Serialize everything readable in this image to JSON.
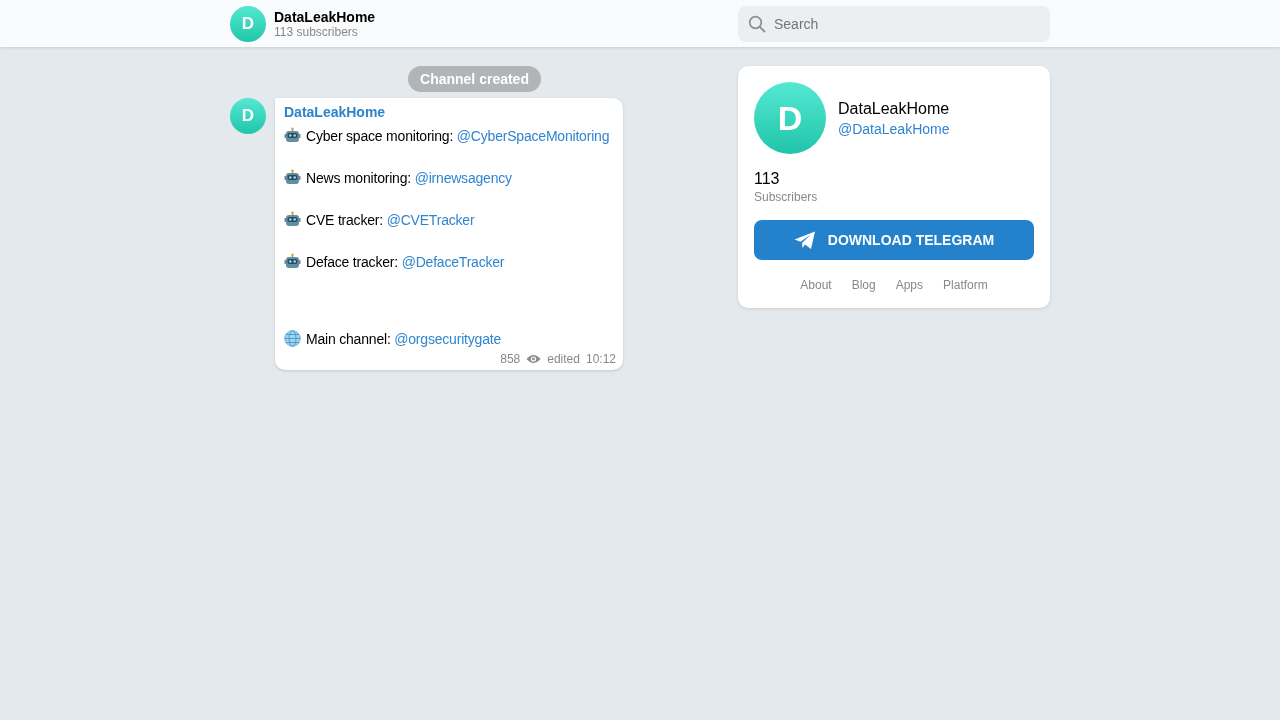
{
  "header": {
    "avatar_letter": "D",
    "title": "DataLeakHome",
    "subtitle": "113 subscribers",
    "search": {
      "placeholder": "Search"
    }
  },
  "service_message": "Channel created",
  "post": {
    "avatar_letter": "D",
    "author": "DataLeakHome",
    "lines": [
      {
        "kind": "bot",
        "text": "Cyber space monitoring: ",
        "link": "@CyberSpaceMonitoring"
      },
      {
        "kind": "bot",
        "text": "News monitoring: ",
        "link": "@irnewsagency"
      },
      {
        "kind": "bot",
        "text": "CVE tracker: ",
        "link": "@CVETracker"
      },
      {
        "kind": "bot",
        "text": "Deface tracker: ",
        "link": "@DefaceTracker"
      },
      {
        "kind": "globe",
        "text": "Main channel: ",
        "link": "@orgsecuritygate"
      }
    ],
    "views": "858",
    "edited": "edited",
    "time": "10:12"
  },
  "profile": {
    "avatar_letter": "D",
    "name": "DataLeakHome",
    "username": "@DataLeakHome",
    "count": "113",
    "count_label": "Subscribers",
    "button": "DOWNLOAD TELEGRAM",
    "links": [
      "About",
      "Blog",
      "Apps",
      "Platform"
    ]
  }
}
